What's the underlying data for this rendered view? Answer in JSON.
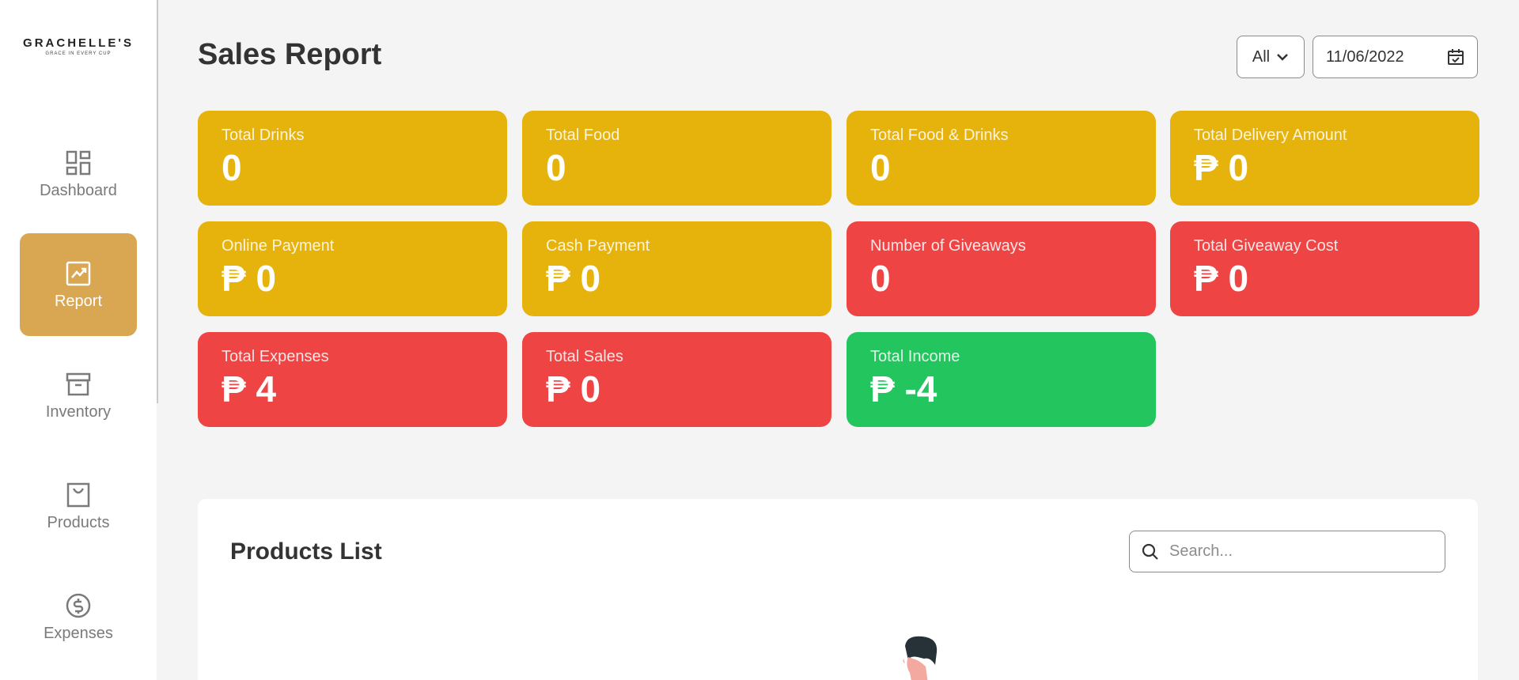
{
  "brand": {
    "name": "GRACHELLE'S",
    "tagline": "GRACE IN EVERY CUP"
  },
  "sidebar": {
    "items": [
      {
        "label": "Dashboard",
        "icon": "dashboard-icon",
        "active": false
      },
      {
        "label": "Report",
        "icon": "report-chart-icon",
        "active": true
      },
      {
        "label": "Inventory",
        "icon": "archive-box-icon",
        "active": false
      },
      {
        "label": "Products",
        "icon": "shopping-bag-icon",
        "active": false
      },
      {
        "label": "Expenses",
        "icon": "dollar-circle-icon",
        "active": false
      }
    ]
  },
  "header": {
    "title": "Sales Report",
    "filter": {
      "selected": "All"
    },
    "date": {
      "value": "11/06/2022"
    }
  },
  "cards": [
    {
      "label": "Total Drinks",
      "value": "0",
      "color": "#e6b30c"
    },
    {
      "label": "Total Food",
      "value": "0",
      "color": "#e6b30c"
    },
    {
      "label": "Total Food & Drinks",
      "value": "0",
      "color": "#e6b30c"
    },
    {
      "label": "Total Delivery Amount",
      "value": "₱ 0",
      "color": "#e6b30c"
    },
    {
      "label": "Online Payment",
      "value": "₱ 0",
      "color": "#e6b30c"
    },
    {
      "label": "Cash Payment",
      "value": "₱ 0",
      "color": "#e6b30c"
    },
    {
      "label": "Number of Giveaways",
      "value": "0",
      "color": "#ef4444"
    },
    {
      "label": "Total Giveaway Cost",
      "value": "₱ 0",
      "color": "#ef4444"
    },
    {
      "label": "Total Expenses",
      "value": "₱ 4",
      "color": "#ef4444"
    },
    {
      "label": "Total Sales",
      "value": "₱ 0",
      "color": "#ef4444"
    },
    {
      "label": "Total Income",
      "value": "₱ -4",
      "color": "#22c55e"
    }
  ],
  "products": {
    "title": "Products List",
    "search_placeholder": "Search..."
  },
  "colors": {
    "accent": "#d9a752",
    "yellow": "#e6b30c",
    "red": "#ef4444",
    "green": "#22c55e"
  }
}
